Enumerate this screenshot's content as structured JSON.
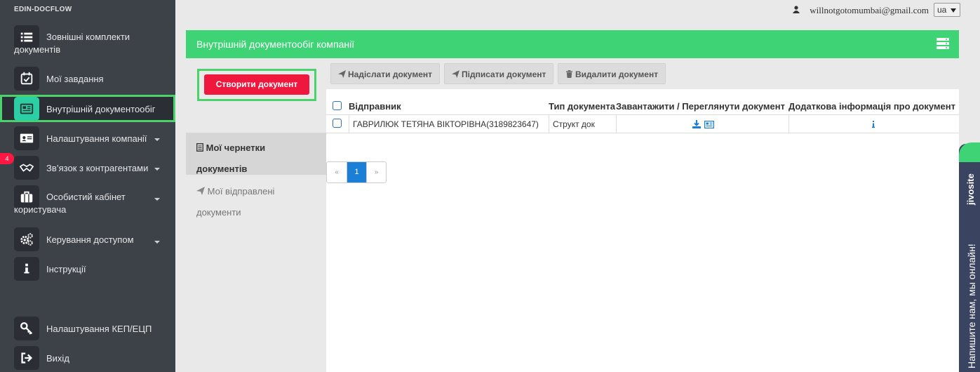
{
  "app": {
    "brand": "EDIN-DOCFLOW"
  },
  "sidebar": {
    "items": [
      {
        "label": "Зовнішні комплекти",
        "label2": "документів",
        "icon": "list-icon"
      },
      {
        "label": "Мої завдання",
        "icon": "calendar-check-icon"
      },
      {
        "label": "Внутрішній документообіг",
        "icon": "newspaper-icon",
        "active": true
      },
      {
        "label": "Налаштування компанії",
        "icon": "id-card-icon"
      },
      {
        "label": "Зв’язок з контрагентами",
        "icon": "handshake-icon"
      },
      {
        "label": "Особистий кабінет",
        "label2": "користувача",
        "icon": "briefcase-icon"
      },
      {
        "label": "Керування доступом",
        "icon": "cogs-icon"
      },
      {
        "label": "Інструкції",
        "icon": "info-icon"
      },
      {
        "label": "Налаштування КЕП/ЕЦП",
        "icon": "key-icon"
      },
      {
        "label": "Вихід",
        "icon": "sign-out-icon"
      }
    ],
    "badge": "4"
  },
  "topbar": {
    "email": "willnotgotomumbai@gmail.com",
    "language": "ua"
  },
  "panel": {
    "title": "Внутрішній документообіг компанії",
    "create_button": "Створити документ",
    "folders": {
      "drafts": "Мої чернетки документів",
      "sent": "Мої відправлені документи"
    },
    "toolbar": {
      "send": "Надіслати документ",
      "sign": "Підписати документ",
      "delete": "Видалити документ"
    },
    "table": {
      "columns": [
        "Відправник",
        "Тип документа",
        "Завантажити / Переглянути документ",
        "Додаткова інформація про документ"
      ],
      "rows": [
        {
          "sender": "ГАВРИЛЮК ТЕТЯНА ВІКТОРІВНА(3189823647)",
          "type": "Структ док",
          "info_icon": "info-icon"
        }
      ]
    },
    "pagination": {
      "prev": "«",
      "current": "1",
      "next": "»"
    }
  },
  "jivo": {
    "brand": "jivosite",
    "text": "Напишите нам, мы онлайн!"
  },
  "colors": {
    "accent_green": "#3ed374",
    "create_red": "#f0173e",
    "sidebar_bg": "#3d4249",
    "link_blue": "#1b7fd5"
  }
}
